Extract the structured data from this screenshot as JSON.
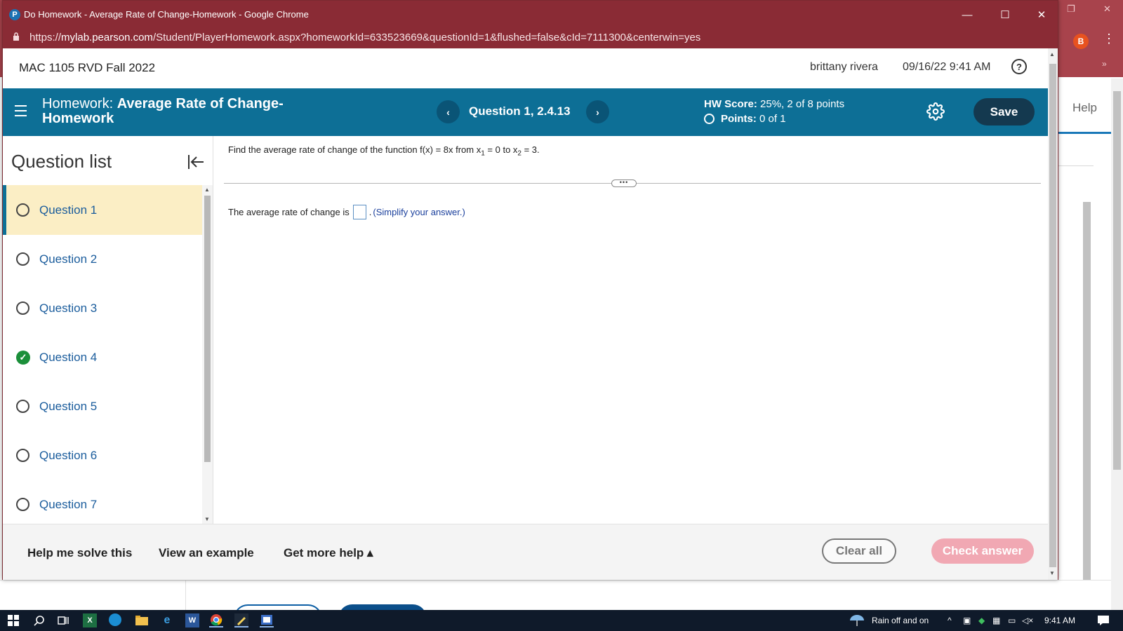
{
  "background": {
    "help_label": "Help",
    "avatar_letter": "B",
    "kebab": "⋮",
    "chevron": "»",
    "restore": "❐",
    "close": "✕"
  },
  "window": {
    "title": "Do Homework - Average Rate of Change-Homework - Google Chrome",
    "logo_letter": "P",
    "url_prefix": "https://",
    "url_host": "mylab.pearson.com",
    "url_path": "/Student/PlayerHomework.aspx?homeworkId=633523669&questionId=1&flushed=false&cId=7111300&centerwin=yes",
    "minimize": "—",
    "maximize": "☐",
    "close": "✕"
  },
  "header": {
    "course": "MAC 1105 RVD Fall 2022",
    "user": "brittany rivera",
    "datetime": "09/16/22 9:41 AM",
    "help_glyph": "?"
  },
  "hw_bar": {
    "prefix": "Homework:",
    "name": "Average Rate of Change-Homework",
    "prev": "‹",
    "question_label": "Question 1, 2.4.13",
    "next": "›",
    "score_label": "HW Score:",
    "score_value": "25%, 2 of 8 points",
    "points_label": "Points:",
    "points_value": "0 of 1",
    "save_label": "Save"
  },
  "sidebar": {
    "title": "Question list",
    "items": [
      {
        "label": "Question 1",
        "status": "active"
      },
      {
        "label": "Question 2",
        "status": "unanswered"
      },
      {
        "label": "Question 3",
        "status": "unanswered"
      },
      {
        "label": "Question 4",
        "status": "correct"
      },
      {
        "label": "Question 5",
        "status": "unanswered"
      },
      {
        "label": "Question 6",
        "status": "unanswered"
      },
      {
        "label": "Question 7",
        "status": "unanswered"
      }
    ]
  },
  "question": {
    "text_before": "Find the average rate of change of the function f(x) = 8x from x",
    "sub1": "1",
    "text_mid": " = 0 to x",
    "sub2": "2",
    "text_after": " = 3.",
    "dots": "•••",
    "answer_prefix": "The average rate of change is",
    "answer_value": "",
    "answer_suffix": ".",
    "hint": "(Simplify your answer.)"
  },
  "footer": {
    "help_solve": "Help me solve this",
    "view_example": "View an example",
    "more_help": "Get more help ▴",
    "clear_all": "Clear all",
    "check_answer": "Check answer"
  },
  "taskbar": {
    "weather": "Rain off and on",
    "time": "9:41 AM"
  },
  "colors": {
    "title_bar": "#8a2b35",
    "hw_bar": "#0d6f96",
    "save_button": "#14394f",
    "active_question": "#fbeec5",
    "correct": "#1b8f3a",
    "check_answer": "#f1a8b3"
  }
}
